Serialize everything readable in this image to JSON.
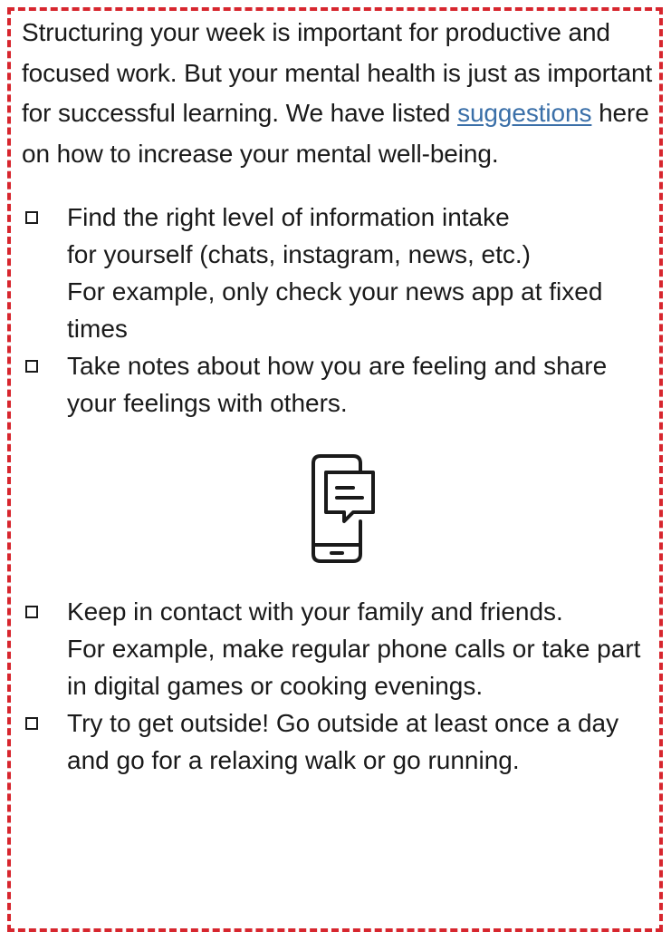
{
  "intro": {
    "text_before": "Structuring your week is important for productive and focused work. But your mental health is just as important for successful learning. We have listed ",
    "link": "suggestions",
    "text_after": " here on how to increase your mental well-being."
  },
  "checklist_top": [
    {
      "line1": "Find the right level of information intake",
      "line2": "for yourself (chats, instagram, news, etc.)",
      "line3": "For example, only check your news app at fixed times"
    },
    {
      "text": "Take notes about how you are feeling and share your feelings with others."
    }
  ],
  "icon": "phone-chat-icon",
  "checklist_bottom": [
    {
      "line1": "Keep in contact with your family and friends.",
      "line2": "For example, make regular phone calls or take part in digital games or cooking evenings."
    },
    {
      "text": "Try to get outside! Go outside at least once a day and go for a relaxing walk or go running."
    }
  ],
  "colors": {
    "border": "#d7262e",
    "link": "#3a6fa8",
    "text": "#1a1a1a"
  }
}
